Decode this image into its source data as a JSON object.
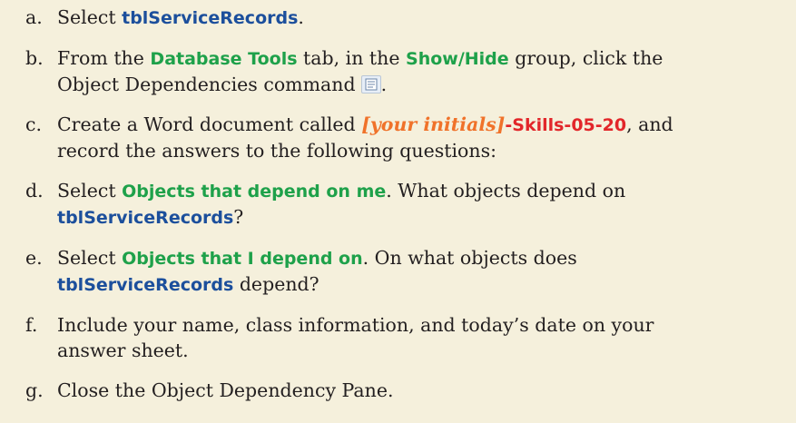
{
  "steps": [
    {
      "marker": "a.",
      "text_before": "Select ",
      "table": "tblServiceRecords",
      "text_after": "."
    },
    {
      "marker": "b.",
      "line1_a": "From the ",
      "tab": "Database Tools",
      "line1_b": " tab, in the ",
      "group": "Show/Hide",
      "line1_c": " group, click the",
      "line2": "Object Dependencies command",
      "icon": "object-dependencies-icon",
      "end": "."
    },
    {
      "marker": "c.",
      "line1_a": "Create a Word document called ",
      "initials": "[your initials]",
      "suffix": "-Skills-05-20",
      "line1_b": ", and",
      "line2": "record the answers to the following questions:"
    },
    {
      "marker": "d.",
      "text_before": "Select ",
      "option": "Objects that depend on me",
      "line1_b": ". What objects depend on",
      "table": "tblServiceRecords",
      "end": "?"
    },
    {
      "marker": "e.",
      "text_before": "Select ",
      "option": "Objects that I depend on",
      "line1_b": ". On what objects does",
      "table": "tblServiceRecords",
      "end": " depend?"
    },
    {
      "marker": "f.",
      "line1": "Include your name, class information, and today’s date on your",
      "line2": "answer sheet."
    },
    {
      "marker": "g.",
      "text": "Close the Object Dependency Pane."
    }
  ],
  "colors": {
    "background": "#f5f0dc",
    "body_text": "#231f20",
    "object_name": "#1c4f9c",
    "ui_label": "#1ea14a",
    "placeholder": "#f0722a",
    "filename_suffix": "#e2262a"
  }
}
